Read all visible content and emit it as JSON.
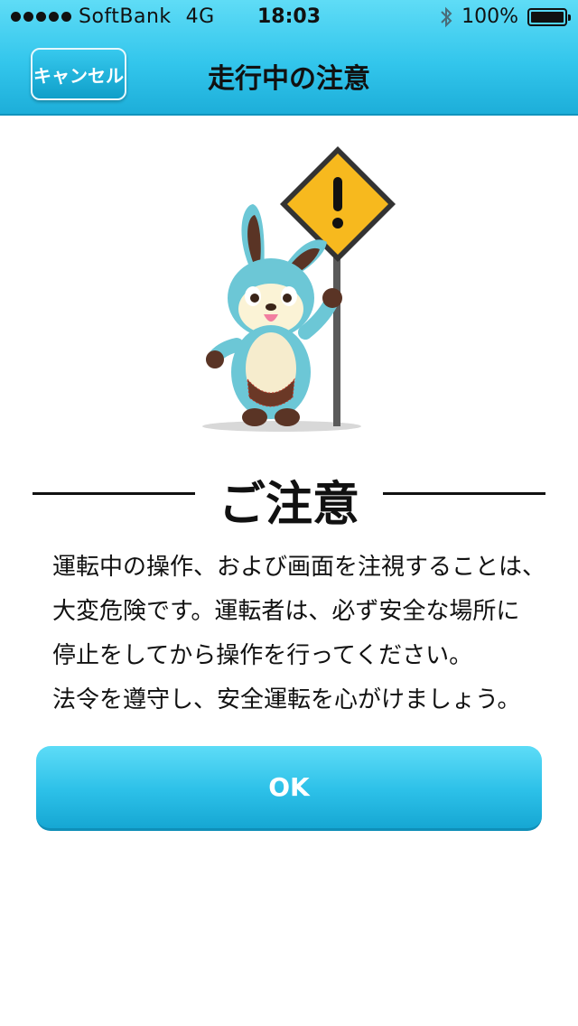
{
  "status_bar": {
    "carrier": "SoftBank",
    "network": "4G",
    "time": "18:03",
    "battery": "100%",
    "bluetooth_icon": "bluetooth-icon",
    "signal_icon": "signal-dots-icon"
  },
  "nav": {
    "cancel_label": "キャンセル",
    "title": "走行中の注意"
  },
  "illustration": {
    "mascot_icon": "rabbit-mascot-holding-warning-sign",
    "sign_icon": "warning-exclamation-sign-icon"
  },
  "notice": {
    "heading": "ご注意",
    "lines": [
      "運転中の操作、および画面を注視することは、",
      "大変危険です。運転者は、必ず安全な場所に",
      "停止をしてから操作を行ってください。",
      "法令を遵守し、安全運転を心がけましょう。"
    ]
  },
  "ok_label": "OK",
  "colors": {
    "accent": "#33c6ec",
    "accent_dark": "#16a7d3",
    "sign_yellow": "#f7b91e"
  }
}
